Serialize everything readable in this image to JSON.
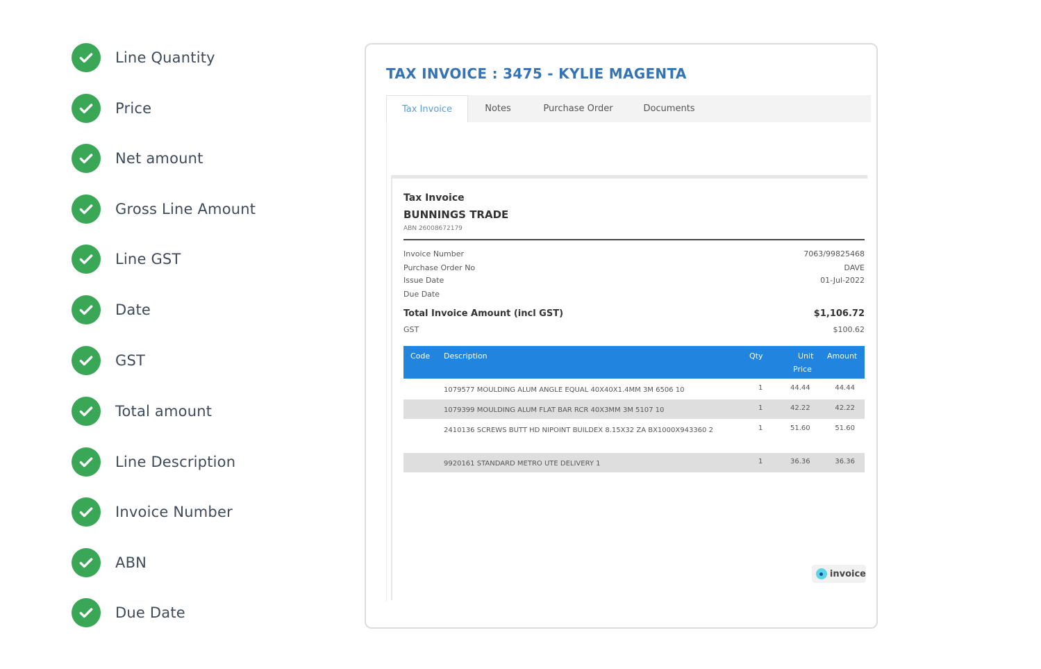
{
  "checklist": [
    {
      "label": "Line Quantity",
      "icon": "check-circle-icon"
    },
    {
      "label": "Price",
      "icon": "check-circle-icon"
    },
    {
      "label": "Net amount",
      "icon": "check-circle-icon"
    },
    {
      "label": "Gross Line Amount",
      "icon": "check-circle-icon"
    },
    {
      "label": "Line GST",
      "icon": "check-circle-icon"
    },
    {
      "label": "Date",
      "icon": "check-circle-icon"
    },
    {
      "label": "GST",
      "icon": "check-circle-icon"
    },
    {
      "label": "Total amount",
      "icon": "check-circle-icon"
    },
    {
      "label": "Line Description",
      "icon": "check-circle-icon"
    },
    {
      "label": "Invoice Number",
      "icon": "check-circle-icon"
    },
    {
      "label": "ABN",
      "icon": "check-circle-icon"
    },
    {
      "label": "Due Date",
      "icon": "check-circle-icon"
    }
  ],
  "colors": {
    "check": "#3aa757",
    "title": "#3574b4",
    "table_header": "#2185e0",
    "active_tab": "#5b9bd5"
  },
  "invoice": {
    "title": "TAX INVOICE : 3475 - KYLIE MAGENTA",
    "tabs": [
      {
        "label": "Tax Invoice",
        "active": true
      },
      {
        "label": "Notes",
        "active": false
      },
      {
        "label": "Purchase Order",
        "active": false
      },
      {
        "label": "Documents",
        "active": false
      }
    ],
    "doc": {
      "heading": "Tax Invoice",
      "supplier": "BUNNINGS TRADE",
      "abn": "ABN 26008672179",
      "meta": [
        {
          "label": "Invoice Number",
          "value": "7063/99825468"
        },
        {
          "label": "Purchase Order No",
          "value": "DAVE"
        },
        {
          "label": "Issue Date",
          "value": "01-Jul-2022"
        },
        {
          "label": "Due Date",
          "value": ""
        }
      ],
      "total_label": "Total Invoice Amount (incl GST)",
      "total_value": "$1,106.72",
      "gst_label": "GST",
      "gst_value": "$100.62",
      "columns": {
        "code": "Code",
        "description": "Description",
        "qty": "Qty",
        "unit_price_1": "Unit",
        "unit_price_2": "Price",
        "amount": "Amount"
      },
      "lines": [
        {
          "description": "1079577 MOULDING ALUM ANGLE EQUAL 40X40X1.4MM 3M 6506 10",
          "qty": "1",
          "unit_price": "44.44",
          "amount": "44.44"
        },
        {
          "description": "1079399 MOULDING ALUM FLAT BAR RCR 40X3MM 3M 5107 10",
          "qty": "1",
          "unit_price": "42.22",
          "amount": "42.22"
        },
        {
          "description": "2410136 SCREWS BUTT HD NIPOINT BUILDEX 8.15X32 ZA BX1000X943360 2",
          "qty": "1",
          "unit_price": "51.60",
          "amount": "51.60"
        },
        {
          "description": "9920161 STANDARD METRO UTE DELIVERY 1",
          "qty": "1",
          "unit_price": "36.36",
          "amount": "36.36"
        }
      ],
      "brand": "invoice"
    }
  }
}
